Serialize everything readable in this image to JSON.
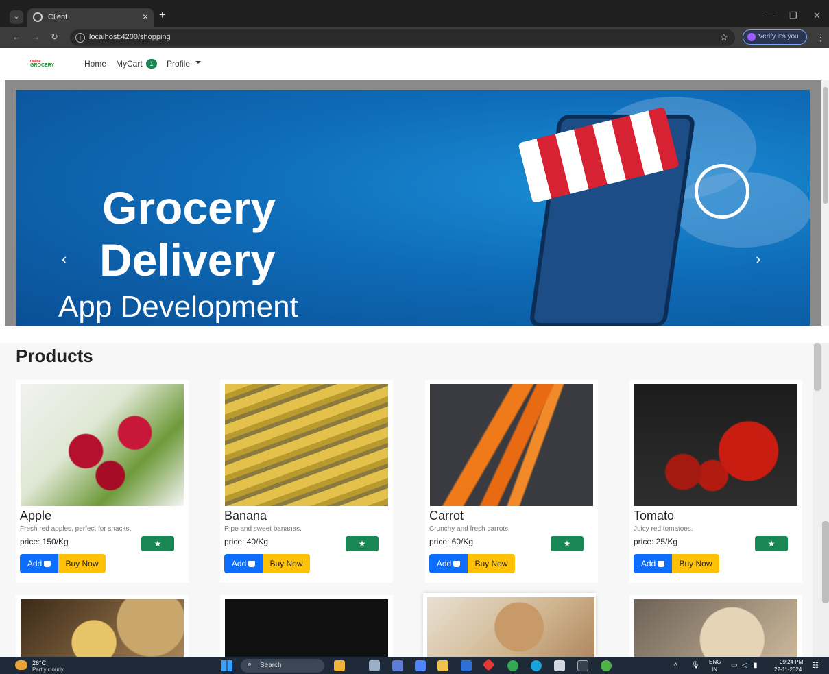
{
  "browser": {
    "tab_title": "Client",
    "url": "localhost:4200/shopping",
    "verify_label": "Verify it's you",
    "new_tab": "+",
    "close_tab": "×"
  },
  "navbar": {
    "logo_top": "Online",
    "logo_main": "GROCERY",
    "home": "Home",
    "cart": "MyCart",
    "cart_count": "1",
    "profile": "Profile"
  },
  "carousel": {
    "line1": "Grocery",
    "line2": "Delivery",
    "line3": "App Development",
    "prev": "‹",
    "next": "›"
  },
  "products": {
    "title": "Products",
    "add_label": "Add",
    "buy_label": "Buy Now",
    "items": [
      {
        "name": "Apple",
        "desc": "Fresh red apples, perfect for snacks.",
        "price": "price: 150/Kg"
      },
      {
        "name": "Banana",
        "desc": "Ripe and sweet bananas.",
        "price": "price: 40/Kg"
      },
      {
        "name": "Carrot",
        "desc": "Crunchy and fresh carrots.",
        "price": "price: 60/Kg"
      },
      {
        "name": "Tomato",
        "desc": "Juicy red tomatoes.",
        "price": "price: 25/Kg"
      }
    ]
  },
  "taskbar": {
    "temp": "26°C",
    "weather": "Partly cloudy",
    "search": "Search",
    "lang": "ENG",
    "region": "IN",
    "time": "09:24 PM",
    "date": "22-11-2024"
  },
  "colors": {
    "primary": "#0d6efd",
    "warning": "#ffc107",
    "success": "#198754"
  }
}
